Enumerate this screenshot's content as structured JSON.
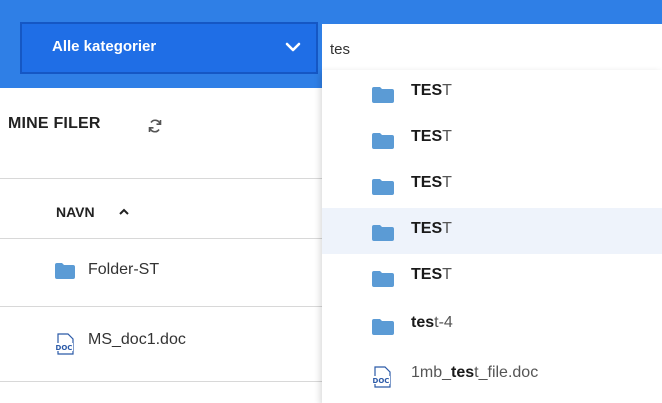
{
  "header": {
    "category_label": "Alle kategorier",
    "search_value": "tes"
  },
  "left": {
    "section_title": "MINE FILER",
    "column_header": "NAVN",
    "rows": [
      {
        "name": "Folder-ST",
        "icon": "folder-icon"
      },
      {
        "name": "MS_doc1.doc",
        "icon": "doc-icon"
      }
    ]
  },
  "results": [
    {
      "match": "TES",
      "rest": "T",
      "icon": "folder-icon"
    },
    {
      "match": "TES",
      "rest": "T",
      "icon": "folder-icon"
    },
    {
      "match": "TES",
      "rest": "T",
      "icon": "folder-icon"
    },
    {
      "match": "TES",
      "rest": "T",
      "icon": "folder-icon"
    },
    {
      "match": "TES",
      "rest": "T",
      "icon": "folder-icon"
    },
    {
      "match": "tes",
      "rest": "t-4",
      "icon": "folder-icon"
    },
    {
      "prefix": "1mb_",
      "match": "tes",
      "rest": "t_file.doc",
      "icon": "doc-icon"
    }
  ],
  "colors": {
    "brand_blue": "#2f7fe6",
    "folder_blue": "#5b9bd5",
    "highlight": "#eef3fb"
  }
}
